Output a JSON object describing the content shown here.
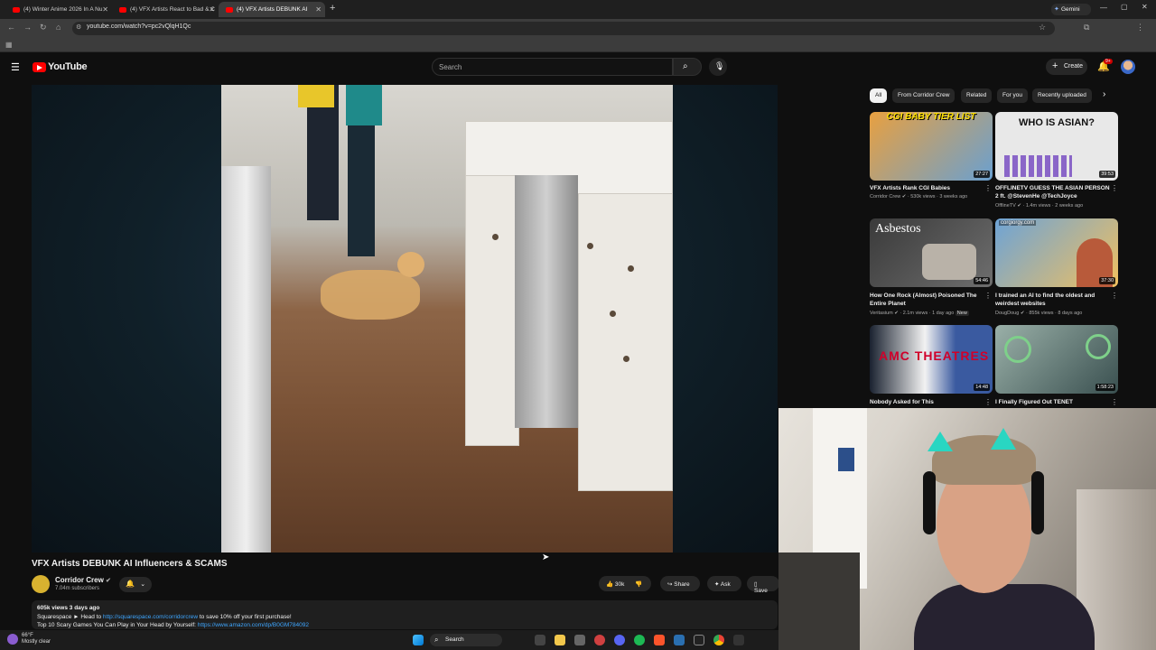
{
  "browser": {
    "tabs": [
      {
        "title": "(4) Winter Anime 2026 In A Nu",
        "active": false
      },
      {
        "title": "(4) VFX Artists React to Bad & C",
        "active": false
      },
      {
        "title": "(4) VFX Artists DEBUNK AI",
        "active": true
      }
    ],
    "new_tab": "+",
    "gemini_label": "Gemini",
    "url": "youtube.com/watch?v=pc2vQlqH1Qc"
  },
  "youtube": {
    "logo_text": "YouTube",
    "search_placeholder": "Search",
    "create_label": "Create",
    "notification_count": "9+"
  },
  "video": {
    "title": "VFX Artists DEBUNK AI Influencers & SCAMS",
    "channel": "Corridor Crew",
    "subscribers": "7.04m subscribers",
    "likes": "30k",
    "share_label": "Share",
    "ask_label": "Ask",
    "save_label": "Save",
    "desc_meta": "605k views  3 days ago",
    "desc_line1_prefix": "Squarespace ► Head to ",
    "desc_line1_link": "http://squarespace.com/corridorcrew",
    "desc_line1_suffix": " to save 10% off your first purchase!",
    "desc_line2_prefix": "Top 10 Scary Games You Can Play in Your Head by Yourself: ",
    "desc_line2_link": "https://www.amazon.com/dp/B0GM784092"
  },
  "chips": [
    "All",
    "From Corridor Crew",
    "Related",
    "For you",
    "Recently uploaded"
  ],
  "recommendations": [
    {
      "title": "VFX Artists Rank CGI Babies",
      "meta": "Corridor Crew ✔ · 530k views · 3 weeks ago",
      "duration": "27:27",
      "thumb_text": "CGI BABY TIER LIST",
      "color": "#c98a3a"
    },
    {
      "title": "OFFLINETV GUESS THE ASIAN PERSON 2 ft. @StevenHe @TechJoyce",
      "meta": "OfflineTV ✔ · 1.4m views · 2 weeks ago",
      "duration": "39:53",
      "thumb_text": "WHO IS ASIAN?",
      "color": "#e4e4e4"
    },
    {
      "title": "How One Rock (Almost) Poisoned The Entire Planet",
      "meta": "Veritasium ✔ · 2.1m views · 1 day ago",
      "badge": "New",
      "duration": "54:46",
      "thumb_text": "Asbestos",
      "color": "#4a4a4a"
    },
    {
      "title": "I trained an AI to find the oldest and weirdest websites",
      "meta": "DougDoug ✔ · 855k views · 8 days ago",
      "duration": "37:30",
      "thumb_text": "corgiorgy.com",
      "color": "#6da3d6"
    },
    {
      "title": "Nobody Asked for This",
      "meta": "",
      "duration": "14:48",
      "thumb_text": "AMC THEATRES",
      "color": "#2b3340"
    },
    {
      "title": "I Finally Figured Out TENET",
      "meta": "",
      "duration": "1:58:23",
      "thumb_text": "",
      "color": "#7b9aa0"
    }
  ],
  "taskbar": {
    "weather_temp": "66°F",
    "weather_desc": "Mostly clear",
    "search_label": "Search"
  }
}
